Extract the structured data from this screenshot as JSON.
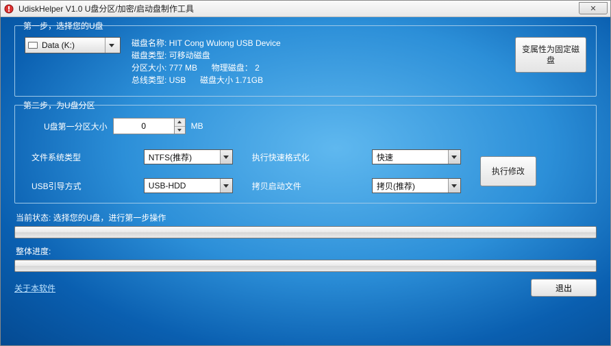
{
  "window": {
    "title": "UdiskHelper V1.0  U盘分区/加密/启动盘制作工具"
  },
  "step1": {
    "legend": "第一步，选择您的U盘",
    "drive_selected": "Data (K:)",
    "info": {
      "name_label": "磁盘名称:",
      "name_value": "HIT Cong Wulong USB Device",
      "type_label": "磁盘类型:",
      "type_value": "可移动磁盘",
      "part_size_label": "分区大小:",
      "part_size_value": "777 MB",
      "phys_label": "物理磁盘：",
      "phys_value": "2",
      "bus_label": "总线类型:",
      "bus_value": "USB",
      "total_label": "磁盘大小",
      "total_value": "1.71GB"
    },
    "convert_button": "变属性为固定磁盘"
  },
  "step2": {
    "legend": "第二步，为U盘分区",
    "first_partition_label": "U盘第一分区大小",
    "first_partition_value": "0",
    "unit": "MB",
    "fs_type_label": "文件系统类型",
    "fs_type_value": "NTFS(推荐)",
    "quick_format_label": "执行快速格式化",
    "quick_format_value": "快速",
    "usb_boot_label": "USB引导方式",
    "usb_boot_value": "USB-HDD",
    "copy_boot_label": "拷贝启动文件",
    "copy_boot_value": "拷贝(推荐)",
    "apply_button": "执行修改"
  },
  "status": {
    "current_label": "当前状态:",
    "current_text": "选择您的U盘，进行第一步操作",
    "overall_label": "整体进度:"
  },
  "footer": {
    "about_link": "关于本软件",
    "exit_button": "退出"
  }
}
